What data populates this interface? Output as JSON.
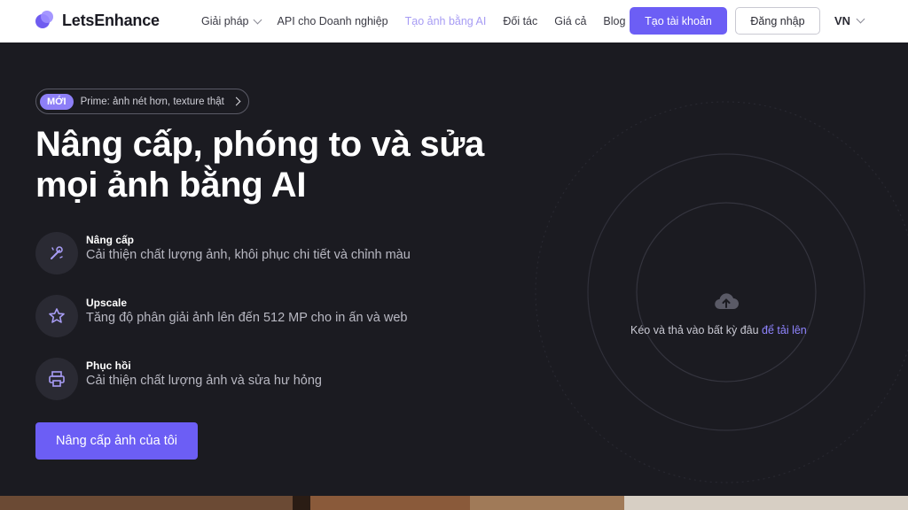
{
  "nav": {
    "logo_text": "LetsEnhance",
    "menu": [
      {
        "label": "Giải pháp",
        "has_dropdown": true,
        "active": false
      },
      {
        "label": "API cho Doanh nghiệp",
        "has_dropdown": false,
        "active": false
      },
      {
        "label": "Tạo ảnh bằng AI",
        "has_dropdown": false,
        "active": true
      },
      {
        "label": "Đối tác",
        "has_dropdown": false,
        "active": false
      },
      {
        "label": "Giá cả",
        "has_dropdown": false,
        "active": false
      },
      {
        "label": "Blog",
        "has_dropdown": false,
        "active": false
      }
    ],
    "signup_label": "Tạo tài khoản",
    "login_label": "Đăng nhập",
    "language": "VN"
  },
  "hero": {
    "badge_new": "MỚI",
    "badge_text": "Prime: ảnh nét hơn, texture thật",
    "headline_line1": "Nâng cấp, phóng to và sửa",
    "headline_line2": "mọi ảnh bằng AI",
    "features": [
      {
        "title": "Nâng cấp",
        "desc": "Cải thiện chất lượng ảnh, khôi phục chi tiết và chỉnh màu",
        "icon": "magic-wand-icon"
      },
      {
        "title": "Upscale",
        "desc": "Tăng độ phân giải ảnh lên đến 512 MP cho in ấn và web",
        "icon": "star-expand-icon"
      },
      {
        "title": "Phục hồi",
        "desc": "Cải thiện chất lượng ảnh và sửa hư hỏng",
        "icon": "printer-icon"
      }
    ],
    "cta_label": "Nâng cấp ảnh của tôi"
  },
  "upload": {
    "text": "Kéo và thả vào bất kỳ đâu",
    "link": "để tải lên",
    "icon": "cloud-upload-icon"
  },
  "colors": {
    "accent": "#6c5ef5",
    "background": "#1b1b21",
    "link": "#8f84ff"
  }
}
